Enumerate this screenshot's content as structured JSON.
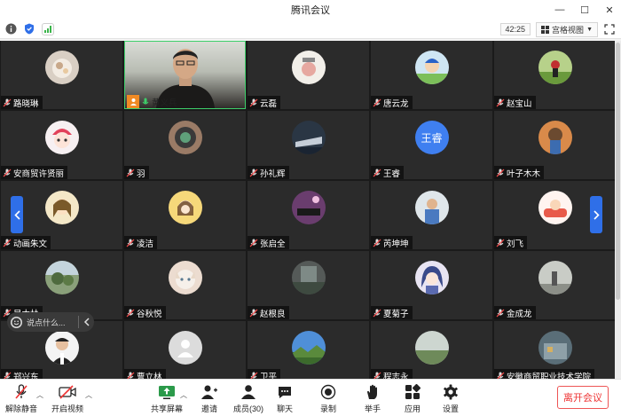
{
  "window": {
    "title": "腾讯会议"
  },
  "infobar": {
    "timer": "42:25",
    "view_label": "宫格视图"
  },
  "participants": [
    {
      "name": "路晓琳"
    },
    {
      "name": "黄义兵"
    },
    {
      "name": "云磊"
    },
    {
      "name": "唐云龙"
    },
    {
      "name": "赵宝山"
    },
    {
      "name": "安商贸许贤丽"
    },
    {
      "name": "羽"
    },
    {
      "name": "孙礼辉"
    },
    {
      "name": "王睿",
      "avatar_text": "王睿"
    },
    {
      "name": "叶子木木"
    },
    {
      "name": "动画朱文"
    },
    {
      "name": "凌洁"
    },
    {
      "name": "张启全"
    },
    {
      "name": "芮坤坤"
    },
    {
      "name": "刘飞"
    },
    {
      "name": "吴木林"
    },
    {
      "name": "谷秋悦"
    },
    {
      "name": "赵根良"
    },
    {
      "name": "夏菊子"
    },
    {
      "name": "金成龙"
    },
    {
      "name": "郑兴东"
    },
    {
      "name": "曹立林"
    },
    {
      "name": "卫平"
    },
    {
      "name": "程志永"
    },
    {
      "name": "安徽商贸职业技术学院"
    }
  ],
  "chat": {
    "placeholder": "说点什么..."
  },
  "toolbar": {
    "mute": "解除静音",
    "video": "开启视频",
    "share": "共享屏幕",
    "invite": "邀请",
    "members": "成员(30)",
    "chat": "聊天",
    "record": "录制",
    "raise": "举手",
    "apps": "应用",
    "settings": "设置",
    "leave": "离开会议"
  },
  "colors": {
    "accent": "#2f6fe8",
    "leave": "#e33333",
    "speaking": "#3ecf6a"
  }
}
